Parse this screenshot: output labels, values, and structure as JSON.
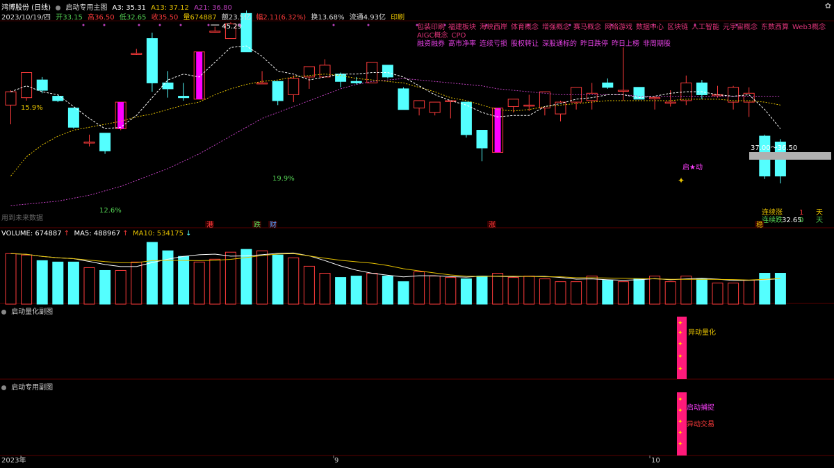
{
  "header": {
    "stock_name": "鸿博股份 (日线)",
    "indicator_name": "启动专用主图",
    "a3": "A3: 35.31",
    "a13": "A13: 37.12",
    "a21": "A21: 36.80",
    "date": "2023/10/19/四",
    "open": "开33.15",
    "high": "高36.50",
    "low": "低32.65",
    "close": "收35.50",
    "volume": "量674887",
    "amount": "额23.5亿",
    "change": "幅2.11(6.32%)",
    "turnover": "换13.68%",
    "float": "流通4.93亿",
    "print_label": "印刷"
  },
  "concept_tags_row1": [
    "包装印刷",
    "福建板块",
    "海峡西岸",
    "体育概念",
    "增强概念",
    "赛马概念",
    "网络游戏",
    "数据中心",
    "区块链",
    "人工智能",
    "元宇宙概念",
    "东数西算",
    "Web3概念",
    "AIGC概念",
    "CPO"
  ],
  "concept_tags_row2": [
    "融资融券",
    "高市净率",
    "连续亏损",
    "股权转让",
    "深股通标的",
    "昨日跌停",
    "昨日上榜",
    "非周期股"
  ],
  "volume_panel": {
    "volume_label": "VOLUME: 674887",
    "ma5_label": "MA5: 488967",
    "ma10_label": "MA10: 534175"
  },
  "sub_panel_1": {
    "title": "启动量化副图",
    "signal_label": "异动量化"
  },
  "sub_panel_2": {
    "title": "启动专用副图",
    "label_a": "启动捕捉",
    "label_b": "异动交易"
  },
  "annotations": {
    "peak": "45.29",
    "p15": "15.9%",
    "p126": "12.6%",
    "p199": "19.9%",
    "range_label": "37.00～36.50",
    "low_label": "32.65",
    "start_label": "启★动",
    "future_note": "用到未来数据",
    "lianzhang": "连续涨",
    "lianzhang_n": "1",
    "lianzhang_unit": "天",
    "liandie": "连续跌",
    "liandie_n": "0",
    "liandie_unit": "天",
    "mark_gang": "港",
    "mark_die": "跌",
    "mark_cai": "财",
    "mark_zhang": "涨",
    "mark_wen": "稳"
  },
  "x_axis": {
    "labels": [
      "2023年",
      "9",
      "10"
    ]
  },
  "colors": {
    "up": "#ff3b3b",
    "down": "#54ffff",
    "magenta": "#ff00ff",
    "ma_white": "#ffffff",
    "ma_yellow": "#e5c100",
    "ma_purple": "#c040c0"
  },
  "chart_data": {
    "type": "candlestick",
    "price_range": [
      32,
      46
    ],
    "candles": [
      {
        "o": 40.3,
        "h": 41.3,
        "l": 39.0,
        "c": 41.2
      },
      {
        "o": 40.8,
        "h": 42.5,
        "l": 40.6,
        "c": 42.5
      },
      {
        "o": 42.0,
        "h": 42.2,
        "l": 41.1,
        "c": 41.3
      },
      {
        "o": 40.9,
        "h": 41.0,
        "l": 40.5,
        "c": 40.6
      },
      {
        "o": 40.1,
        "h": 40.1,
        "l": 38.7,
        "c": 38.8
      },
      {
        "o": 37.8,
        "h": 38.3,
        "l": 37.5,
        "c": 37.8
      },
      {
        "o": 38.4,
        "h": 38.4,
        "l": 37.0,
        "c": 37.2
      },
      {
        "o": 38.7,
        "h": 40.5,
        "l": 38.6,
        "c": 40.5
      },
      {
        "o": 43.8,
        "h": 44.1,
        "l": 43.7,
        "c": 43.8
      },
      {
        "o": 44.8,
        "h": 45.2,
        "l": 41.2,
        "c": 41.8
      },
      {
        "o": 41.8,
        "h": 42.6,
        "l": 40.8,
        "c": 41.4
      },
      {
        "o": 40.9,
        "h": 41.8,
        "l": 40.6,
        "c": 40.8
      },
      {
        "o": 40.7,
        "h": 43.9,
        "l": 40.7,
        "c": 43.9
      },
      {
        "o": 45.3,
        "h": 45.6,
        "l": 45.2,
        "c": 45.3
      },
      {
        "o": 44.8,
        "h": 45.9,
        "l": 44.8,
        "c": 45.8
      },
      {
        "o": 46.5,
        "h": 46.7,
        "l": 44.3,
        "c": 43.9
      },
      {
        "o": 41.8,
        "h": 42.6,
        "l": 41.8,
        "c": 41.8
      },
      {
        "o": 41.9,
        "h": 41.9,
        "l": 40.3,
        "c": 40.6
      },
      {
        "o": 41.0,
        "h": 42.3,
        "l": 40.5,
        "c": 42.1
      },
      {
        "o": 42.2,
        "h": 42.8,
        "l": 41.4,
        "c": 42.9
      },
      {
        "o": 42.2,
        "h": 43.4,
        "l": 42.2,
        "c": 43.0
      },
      {
        "o": 42.4,
        "h": 42.5,
        "l": 41.5,
        "c": 41.9
      },
      {
        "o": 41.9,
        "h": 42.2,
        "l": 41.7,
        "c": 41.8
      },
      {
        "o": 41.8,
        "h": 43.1,
        "l": 41.8,
        "c": 43.2
      },
      {
        "o": 43.0,
        "h": 43.0,
        "l": 42.1,
        "c": 42.2
      },
      {
        "o": 41.4,
        "h": 41.5,
        "l": 40.0,
        "c": 40.0
      },
      {
        "o": 40.1,
        "h": 40.6,
        "l": 39.6,
        "c": 40.6
      },
      {
        "o": 39.8,
        "h": 40.5,
        "l": 39.6,
        "c": 40.5
      },
      {
        "o": 40.6,
        "h": 40.6,
        "l": 39.4,
        "c": 40.6
      },
      {
        "o": 40.5,
        "h": 40.5,
        "l": 38.1,
        "c": 38.3
      },
      {
        "o": 38.6,
        "h": 38.6,
        "l": 36.5,
        "c": 37.4
      },
      {
        "o": 37.1,
        "h": 40.1,
        "l": 37.1,
        "c": 40.1
      },
      {
        "o": 40.2,
        "h": 40.7,
        "l": 39.8,
        "c": 40.7
      },
      {
        "o": 40.3,
        "h": 41.0,
        "l": 39.9,
        "c": 40.3
      },
      {
        "o": 40.1,
        "h": 41.2,
        "l": 39.6,
        "c": 41.2
      },
      {
        "o": 39.7,
        "h": 40.6,
        "l": 39.2,
        "c": 40.5
      },
      {
        "o": 40.5,
        "h": 41.3,
        "l": 40.0,
        "c": 41.5
      },
      {
        "o": 40.6,
        "h": 41.8,
        "l": 40.0,
        "c": 41.1
      },
      {
        "o": 41.8,
        "h": 42.1,
        "l": 41.4,
        "c": 41.5
      },
      {
        "o": 41.3,
        "h": 44.2,
        "l": 40.6,
        "c": 41.3
      },
      {
        "o": 41.5,
        "h": 41.5,
        "l": 40.7,
        "c": 40.7
      },
      {
        "o": 40.8,
        "h": 40.9,
        "l": 40.0,
        "c": 40.8
      },
      {
        "o": 40.5,
        "h": 41.3,
        "l": 40.2,
        "c": 40.5
      },
      {
        "o": 40.6,
        "h": 42.3,
        "l": 40.3,
        "c": 41.8
      },
      {
        "o": 41.8,
        "h": 42.0,
        "l": 40.7,
        "c": 41.0
      },
      {
        "o": 41.0,
        "h": 41.6,
        "l": 40.8,
        "c": 41.0
      },
      {
        "o": 40.5,
        "h": 41.6,
        "l": 40.0,
        "c": 41.5
      },
      {
        "o": 40.5,
        "h": 41.5,
        "l": 39.5,
        "c": 41.1
      },
      {
        "o": 38.2,
        "h": 38.3,
        "l": 35.3,
        "c": 35.5
      },
      {
        "o": 37.8,
        "h": 38.0,
        "l": 35.0,
        "c": 35.5
      }
    ],
    "volume": [
      36,
      35,
      31,
      30,
      30,
      26,
      24,
      24,
      30,
      44,
      38,
      34,
      30,
      32,
      37,
      39,
      38,
      35,
      33,
      27,
      22,
      19,
      20,
      22,
      20,
      16,
      23,
      20,
      19,
      18,
      20,
      22,
      19,
      20,
      18,
      16,
      16,
      20,
      17,
      16,
      18,
      20,
      16,
      20,
      18,
      15,
      15,
      17,
      22,
      22
    ],
    "ma_white": [
      41.2,
      41.6,
      41.2,
      41.0,
      40.2,
      39.4,
      38.7,
      38.8,
      39.6,
      40.8,
      42.0,
      42.4,
      42.2,
      43.2,
      44.2,
      44.3,
      43.6,
      42.6,
      42.4,
      42.0,
      42.2,
      42.4,
      42.4,
      42.5,
      42.5,
      42.2,
      41.6,
      41.0,
      40.6,
      40.3,
      39.8,
      39.5,
      39.6,
      39.6,
      40.2,
      40.4,
      40.7,
      40.8,
      41.0,
      41.0,
      40.8,
      40.9,
      41.1,
      41.2,
      41.2,
      41.0,
      40.9,
      41.0,
      40.0,
      38.7
    ],
    "ma_yellow": [
      35.5,
      36.8,
      37.6,
      38.2,
      38.6,
      38.8,
      39.0,
      39.2,
      39.5,
      39.7,
      40.0,
      40.3,
      40.5,
      41.0,
      41.4,
      41.7,
      41.9,
      42.0,
      42.2,
      42.3,
      42.4,
      42.3,
      42.1,
      42.0,
      41.9,
      41.8,
      41.5,
      41.2,
      40.8,
      40.6,
      40.3,
      40.0,
      39.9,
      40.0,
      40.2,
      40.3,
      40.4,
      40.5,
      40.6,
      40.6,
      40.6,
      40.6,
      40.6,
      40.7,
      40.7,
      40.7,
      40.6,
      40.6,
      40.5,
      40.3
    ],
    "ma_purple": [
      33.5,
      33.6,
      33.7,
      33.8,
      34.0,
      34.2,
      34.5,
      34.8,
      35.2,
      35.6,
      36.0,
      36.5,
      37.0,
      37.6,
      38.2,
      38.8,
      39.4,
      39.8,
      40.2,
      40.6,
      41.0,
      41.4,
      41.7,
      41.9,
      42.0,
      42.1,
      42.0,
      41.9,
      41.8,
      41.7,
      41.6,
      41.4,
      41.3,
      41.2,
      41.1,
      41.0,
      41.0,
      41.0,
      41.0,
      41.0,
      40.9,
      40.9,
      40.9,
      40.9,
      40.9,
      40.9,
      40.9,
      40.9,
      40.9,
      40.9
    ]
  }
}
